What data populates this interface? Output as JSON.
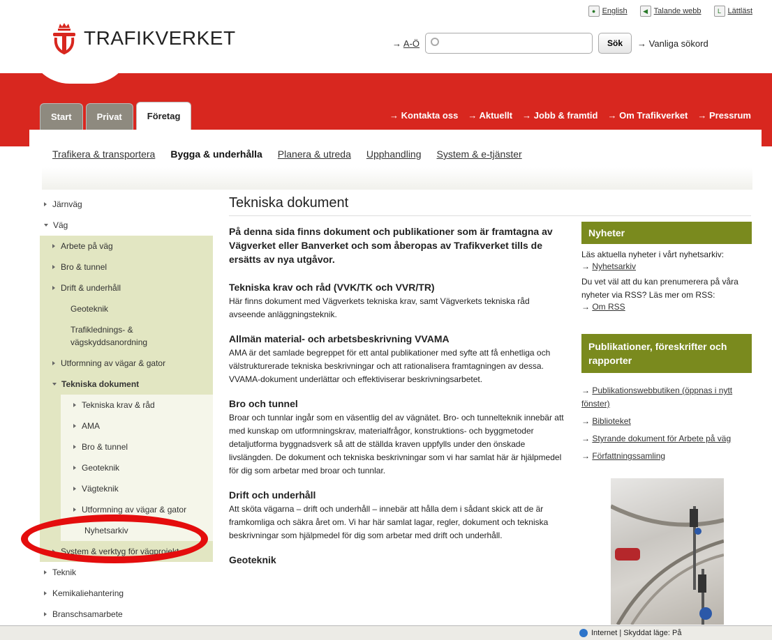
{
  "utility": {
    "english": "English",
    "talande": "Talande webb",
    "lattlast": "Lättläst"
  },
  "logo": {
    "text": "TRAFIKVERKET"
  },
  "search": {
    "ao": "A-Ö",
    "placeholder": "",
    "button": "Sök",
    "common": "Vanliga sökord"
  },
  "tabs": [
    {
      "label": "Start"
    },
    {
      "label": "Privat"
    },
    {
      "label": "Företag"
    }
  ],
  "toplinks": [
    {
      "label": "Kontakta oss"
    },
    {
      "label": "Aktuellt"
    },
    {
      "label": "Jobb & framtid"
    },
    {
      "label": "Om Trafikverket"
    },
    {
      "label": "Pressrum"
    }
  ],
  "subnav": [
    {
      "label": "Trafikera & transportera"
    },
    {
      "label": "Bygga & underhålla"
    },
    {
      "label": "Planera & utreda"
    },
    {
      "label": "Upphandling"
    },
    {
      "label": "System & e-tjänster"
    }
  ],
  "leftnav": [
    {
      "label": "Järnväg"
    },
    {
      "label": "Väg"
    },
    {
      "label": "Arbete på väg"
    },
    {
      "label": "Bro & tunnel"
    },
    {
      "label": "Drift & underhåll"
    },
    {
      "label": "Geoteknik"
    },
    {
      "label": "Trafikledningsanordning-line1",
      "l1": "Trafiklednings- &",
      "l2": "vägskyddsanordning"
    },
    {
      "label": "Utformning av vägar & gator"
    },
    {
      "label": "Tekniska dokument"
    },
    {
      "label": "Tekniska krav & råd"
    },
    {
      "label": "AMA"
    },
    {
      "label": "Bro & tunnel"
    },
    {
      "label": "Geoteknik"
    },
    {
      "label": "Vägteknik"
    },
    {
      "label": "Utformning av vägar & gator"
    },
    {
      "label": "Nyhetsarkiv"
    },
    {
      "label": "System & verktyg för vägprojekt"
    },
    {
      "label": "Teknik"
    },
    {
      "label": "Kemikaliehantering"
    },
    {
      "label": "Branschsamarbete"
    }
  ],
  "main": {
    "title": "Tekniska dokument",
    "lead": "På denna sida finns dokument och publikationer som är framtagna av Vägverket eller Banverket och som åberopas av Trafikverket tills de ersätts av nya utgåvor.",
    "sections": [
      {
        "h": "Tekniska krav och råd (VVK/TK och VVR/TR)",
        "p": "Här finns dokument med Vägverkets tekniska krav, samt Vägverkets tekniska råd avseende anläggningsteknik."
      },
      {
        "h": "Allmän material- och arbetsbeskrivning VVAMA",
        "p": "AMA är det samlade begreppet för ett antal publikationer med syfte att få enhetliga och välstrukturerade tekniska beskrivningar och att rationalisera framtagningen av dessa. VVAMA-dokument underlättar och effektiviserar beskrivningsarbetet."
      },
      {
        "h": "Bro och tunnel",
        "p": "Broar och tunnlar ingår som en väsentlig del av vägnätet. Bro- och tunnelteknik innebär att med kunskap om utformningskrav, materialfrågor, konstruktions- och byggmetoder detaljutforma byggnadsverk så att de ställda kraven uppfylls under den önskade livslängden. De dokument och tekniska beskrivningar som vi har samlat här är hjälpmedel för dig som arbetar med broar och tunnlar."
      },
      {
        "h": "Drift och underhåll",
        "p": "Att sköta vägarna – drift och underhåll – innebär att hålla dem i sådant skick att de är framkomliga och säkra året om. Vi har här samlat lagar, regler, dokument och tekniska beskrivningar som hjälpmedel för dig som arbetar med drift och underhåll."
      },
      {
        "h": "Geoteknik",
        "p": ""
      }
    ]
  },
  "right": {
    "news_title": "Nyheter",
    "news_p1": "Läs aktuella nyheter i vårt nyhetsarkiv:",
    "news_l1": "Nyhetsarkiv",
    "news_p2": "Du vet väl att du kan prenumerera på våra nyheter via RSS? Läs mer om RSS:",
    "news_l2": "Om RSS",
    "pub_title": "Publikationer, föreskrifter och rapporter",
    "pub_links": [
      {
        "label": "Publikationswebbutiken (öppnas i nytt fönster)"
      },
      {
        "label": "Biblioteket"
      },
      {
        "label": "Styrande dokument för Arbete på väg"
      },
      {
        "label": "Författningssamling"
      }
    ]
  },
  "status": {
    "text": "Internet | Skyddat läge: På"
  }
}
